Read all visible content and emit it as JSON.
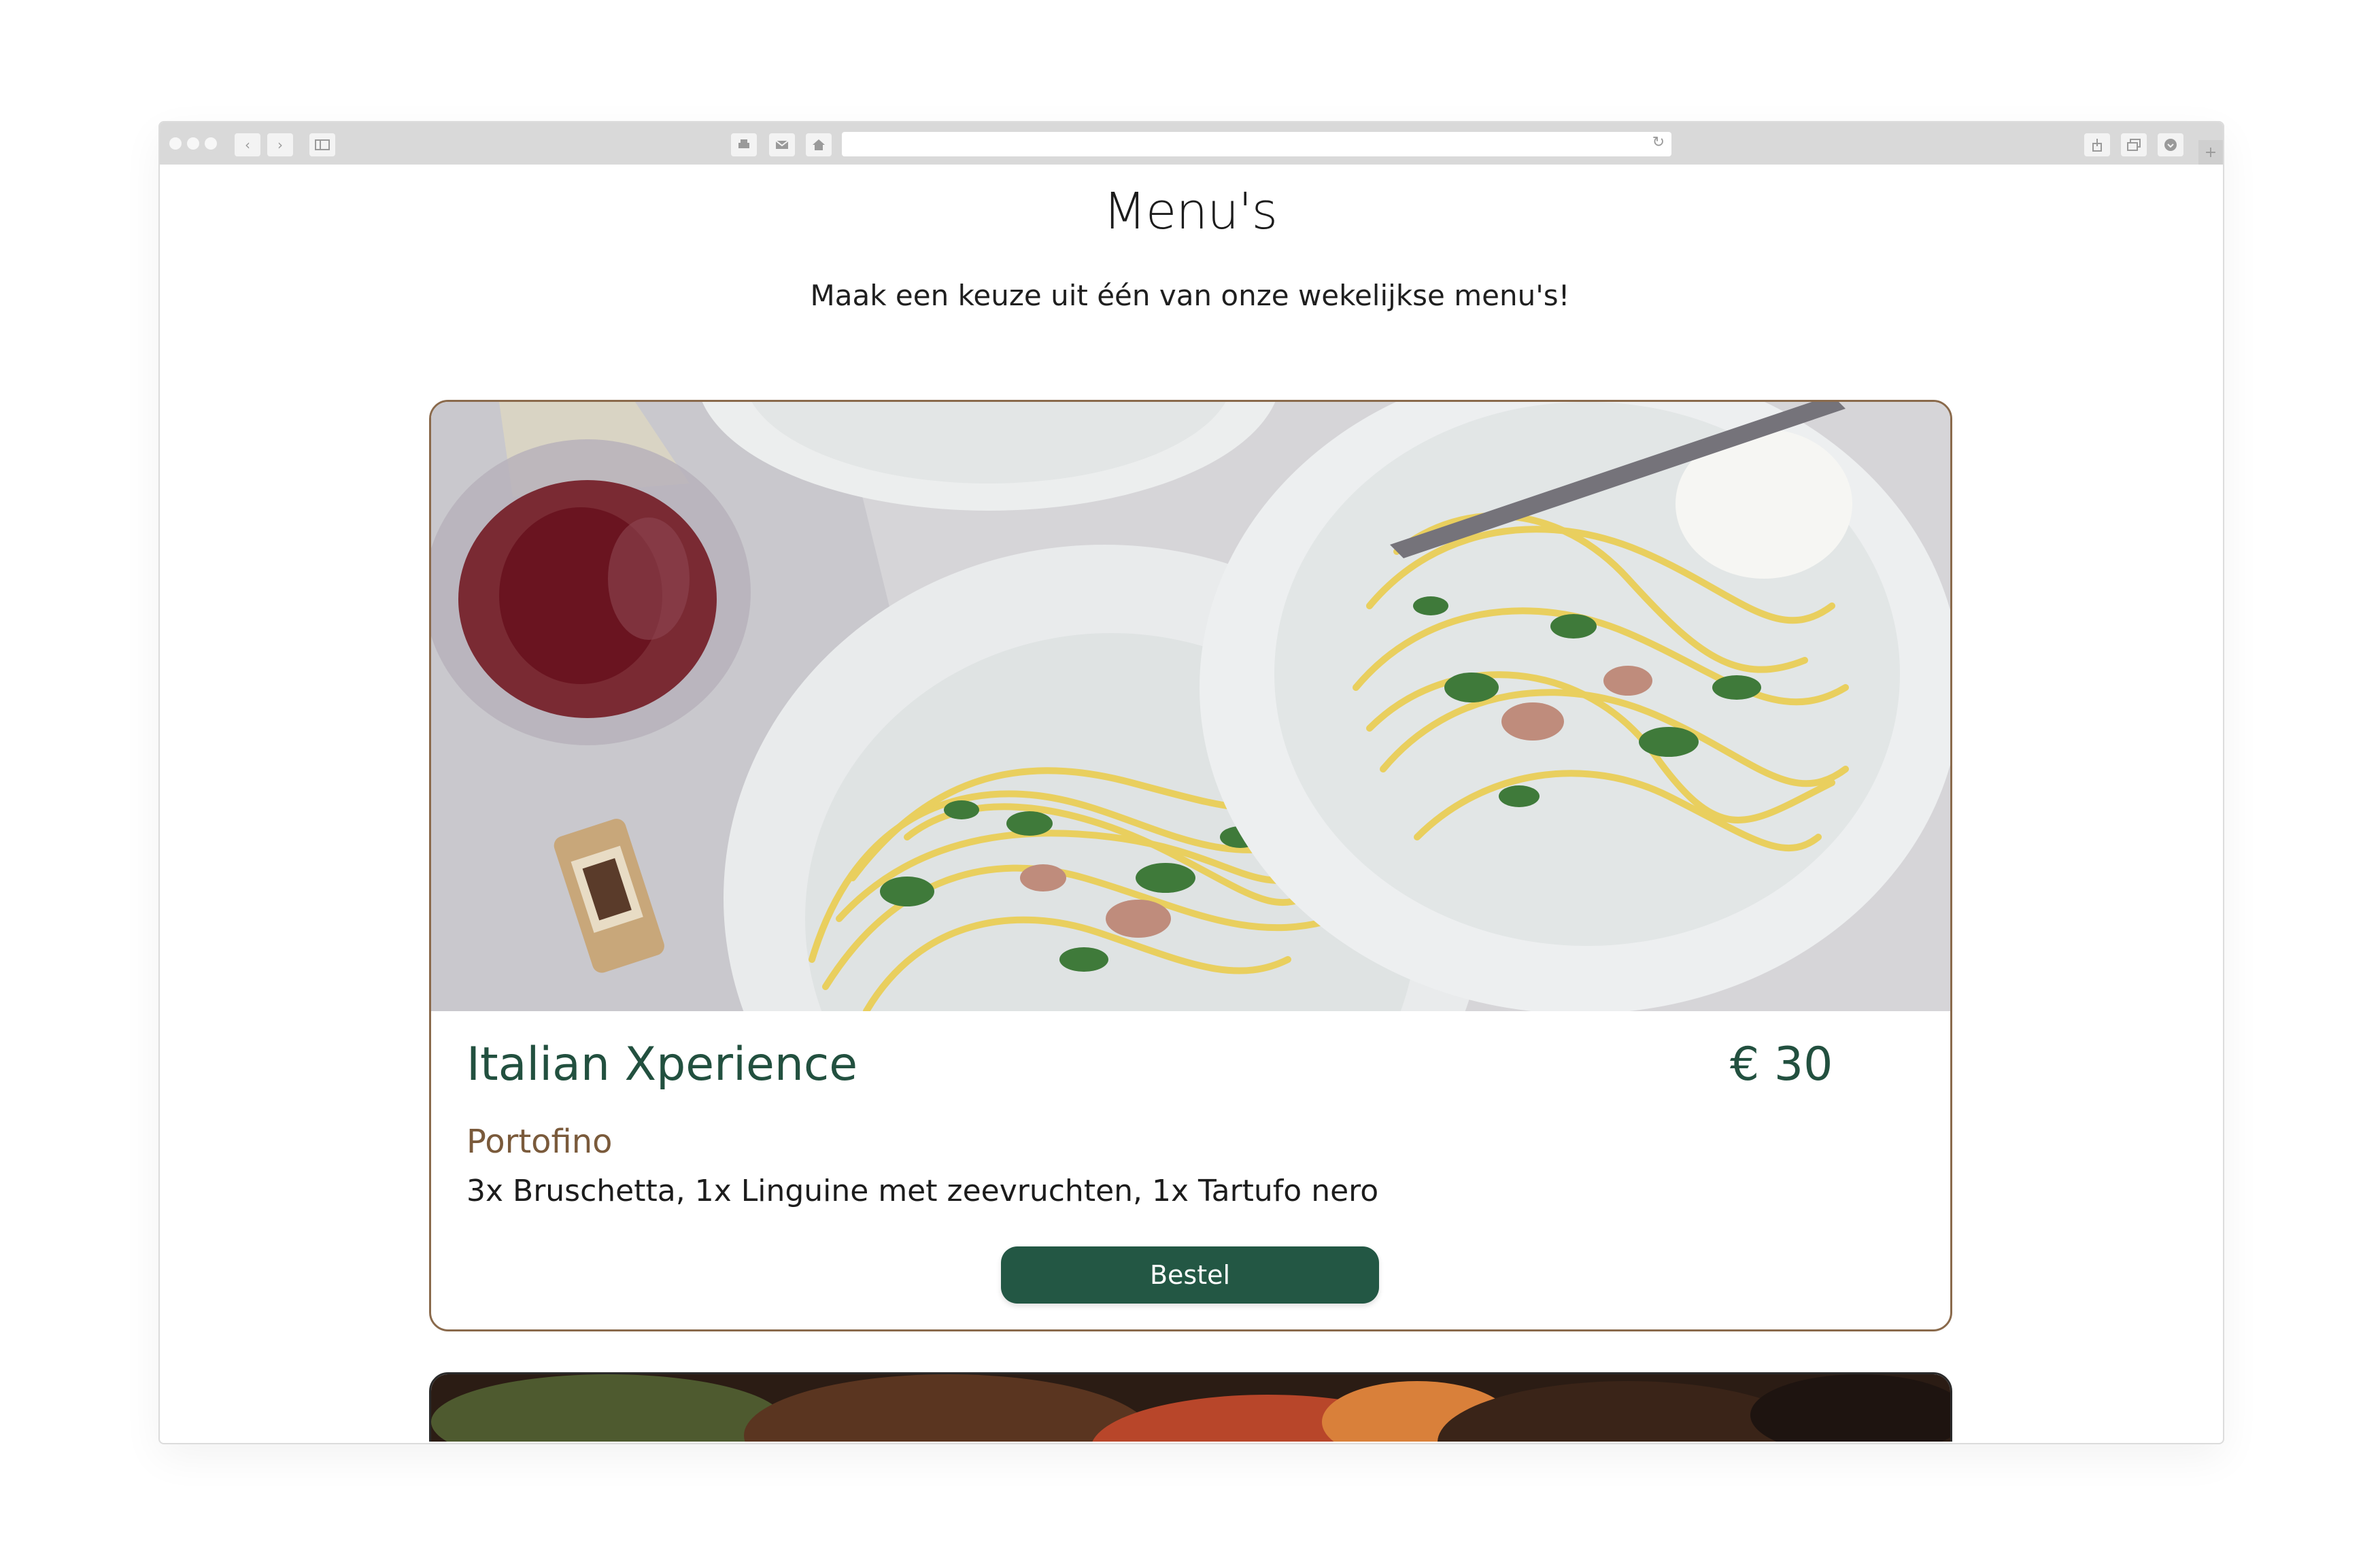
{
  "page": {
    "title": "Menu's",
    "subtitle": "Maak een keuze uit één van onze wekelijkse menu's!"
  },
  "menus": [
    {
      "title": "Italian Xperience",
      "price": "€ 30",
      "subtitle": "Portofino",
      "description": "3x Bruschetta, 1x Linguine met zeevruchten, 1x Tartufo nero",
      "button_label": "Bestel",
      "image": "pasta-dishes-with-wine-photo"
    },
    {
      "image": "roasted-vegetables-photo"
    }
  ],
  "browser_chrome": {
    "icons": [
      "back-icon",
      "forward-icon",
      "sidebar-icon",
      "print-icon",
      "mail-icon",
      "home-icon",
      "reload-icon",
      "share-icon",
      "tabs-icon",
      "download-icon",
      "new-tab-icon"
    ]
  },
  "colors": {
    "accent_green": "#235744",
    "accent_brown": "#7a5a3b",
    "card_border": "#8a6a4c"
  }
}
